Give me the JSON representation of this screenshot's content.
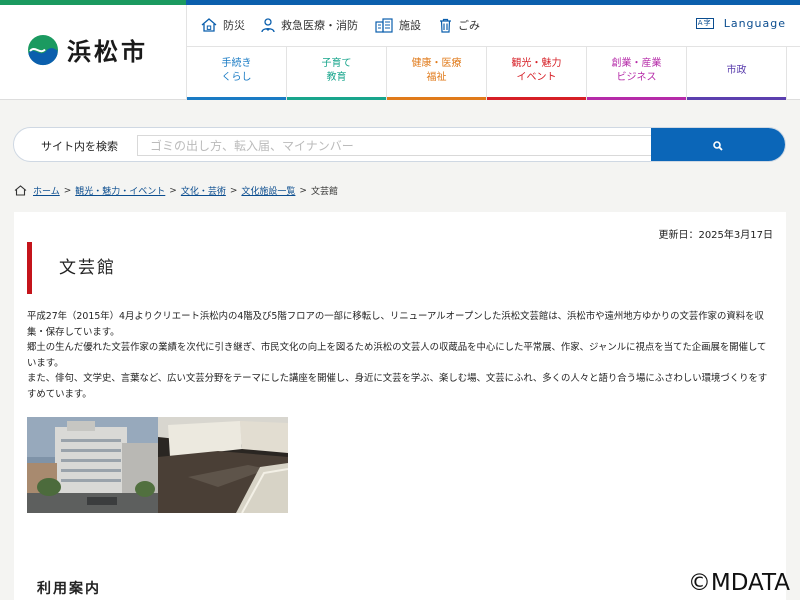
{
  "site": {
    "name": "浜松市"
  },
  "utility_nav": [
    {
      "label": "防災",
      "icon": "house-shield-icon"
    },
    {
      "label": "救急医療・消防",
      "icon": "doctor-icon"
    },
    {
      "label": "施設",
      "icon": "building-icon"
    },
    {
      "label": "ごみ",
      "icon": "trash-icon"
    }
  ],
  "language": {
    "icon_text": "A字",
    "label": "Language"
  },
  "global_nav": [
    {
      "line1": "手続き",
      "line2": "くらし",
      "color": "#1a7bc4"
    },
    {
      "line1": "子育て",
      "line2": "教育",
      "color": "#18a58c"
    },
    {
      "line1": "健康・医療",
      "line2": "福祉",
      "color": "#e07a1a"
    },
    {
      "line1": "観光・魅力",
      "line2": "イベント",
      "color": "#d61f26"
    },
    {
      "line1": "創業・産業",
      "line2": "ビジネス",
      "color": "#b52aa8"
    },
    {
      "line1": "市政",
      "line2": "",
      "color": "#5b3fae"
    }
  ],
  "search": {
    "label": "サイト内を検索",
    "placeholder": "ゴミの出し方、転入届、マイナンバー"
  },
  "breadcrumb": {
    "links": [
      "ホーム",
      "観光・魅力・イベント",
      "文化・芸術",
      "文化施設一覧"
    ],
    "current": "文芸館"
  },
  "page": {
    "updated": "更新日：2025年3月17日",
    "title": "文芸館",
    "paragraphs": [
      "平成27年（2015年）4月よりクリエート浜松内の4階及び5階フロアの一部に移転し、リニューアルオープンした浜松文芸館は、浜松市や遠州地方ゆかりの文芸作家の資料を収集・保存しています。",
      "郷土の生んだ優れた文芸作家の業績を次代に引き継ぎ、市民文化の向上を図るため浜松の文芸人の収蔵品を中心にした平常展、作家、ジャンルに視点を当てた企画展を開催しています。",
      "また、俳句、文学史、言葉など、広い文芸分野をテーマにした講座を開催し、身近に文芸を学ぶ、楽しむ場、文芸にふれ、多くの人々と語り合う場にふさわしい環境づくりをすすめています。"
    ],
    "section_heading": "利用案内"
  },
  "watermark": "©MDATA",
  "colors": {
    "brand_green": "#1b9a60",
    "brand_blue": "#0b5fad",
    "title_accent": "#c4141b",
    "search_button": "#0b66b8"
  }
}
